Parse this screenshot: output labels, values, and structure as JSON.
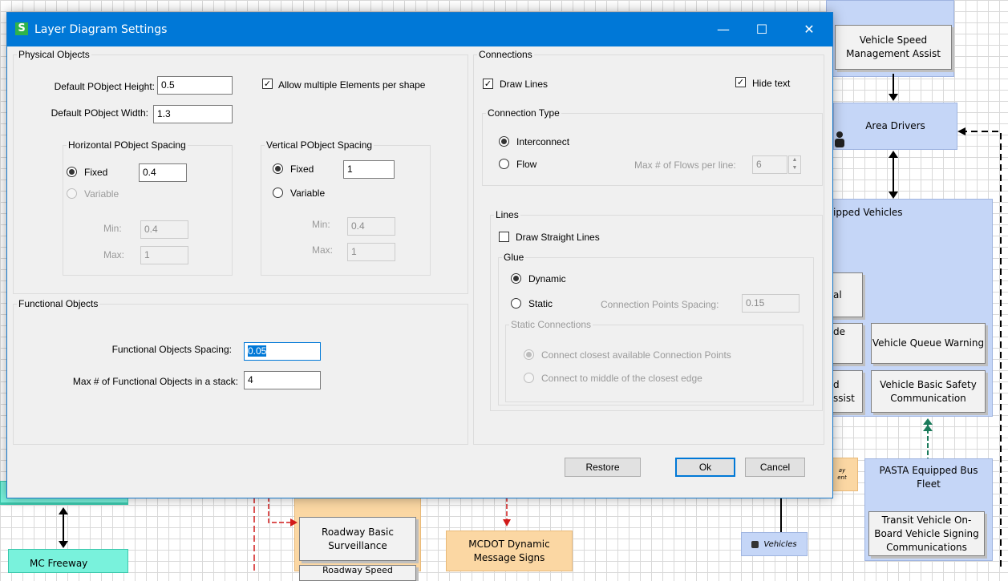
{
  "window": {
    "title": "Layer Diagram Settings",
    "logo_letter": "S",
    "minimize_glyph": "—",
    "maximize_glyph": "☐",
    "close_glyph": "✕"
  },
  "physical": {
    "legend": "Physical Objects",
    "height_label": "Default PObject Height:",
    "height_value": "0.5",
    "width_label": "Default PObject Width:",
    "width_value": "1.3",
    "allow_multiple_label": "Allow multiple Elements per shape",
    "allow_multiple_checked": true,
    "horizontal": {
      "legend": "Horizontal PObject Spacing",
      "fixed_label": "Fixed",
      "fixed_value": "0.4",
      "variable_label": "Variable",
      "min_label": "Min:",
      "min_value": "0.4",
      "max_label": "Max:",
      "max_value": "1"
    },
    "vertical": {
      "legend": "Vertical PObject Spacing",
      "fixed_label": "Fixed",
      "fixed_value": "1",
      "variable_label": "Variable",
      "min_label": "Min:",
      "min_value": "0.4",
      "max_label": "Max:",
      "max_value": "1"
    }
  },
  "functional": {
    "legend": "Functional Objects",
    "spacing_label": "Functional Objects Spacing:",
    "spacing_value": "0.05",
    "max_stack_label": "Max # of Functional Objects in a stack:",
    "max_stack_value": "4"
  },
  "connections": {
    "legend": "Connections",
    "draw_lines_label": "Draw Lines",
    "hide_text_label": "Hide text",
    "type": {
      "legend": "Connection Type",
      "interconnect_label": "Interconnect",
      "flow_label": "Flow",
      "max_flows_label": "Max # of Flows per line:",
      "max_flows_value": "6",
      "selected": "Interconnect"
    },
    "lines": {
      "legend": "Lines",
      "straight_label": "Draw Straight Lines",
      "glue": {
        "legend": "Glue",
        "dynamic_label": "Dynamic",
        "static_label": "Static",
        "spacing_label": "Connection Points Spacing:",
        "spacing_value": "0.15",
        "selected": "Dynamic"
      },
      "static_connections": {
        "legend": "Static Connections",
        "closest_label": "Connect closest available Connection Points",
        "middle_label": "Connect to middle of the closest edge"
      }
    }
  },
  "buttons": {
    "restore": "Restore",
    "ok": "Ok",
    "cancel": "Cancel"
  },
  "diagram": {
    "nodes": {
      "speed_mgmt": "Vehicle Speed Management Assist",
      "area_drivers": "Area Drivers",
      "equipped_vehicles": "ipped Vehicles",
      "frag_al": "al",
      "frag_de": "de",
      "frag_d": "d",
      "frag_ssist": "ssist",
      "queue_warning": "Vehicle Queue Warning",
      "basic_safety": "Vehicle Basic Safety Communication",
      "frag_orange": "ay\nent",
      "pasta_bus": "PASTA Equipped Bus Fleet",
      "transit_signing": "Transit Vehicle On-Board Vehicle Signing Communications",
      "roadway_surveillance": "Roadway Basic Surveillance",
      "roadway_speed": "Roadway Speed",
      "mcdot_signs": "MCDOT Dynamic Message Signs",
      "vehicles": "Vehicles",
      "mc_freeway": "MC Freeway"
    },
    "colors": {
      "gray_node": "#f2f2f2",
      "blue_node": "#c5d6f7",
      "orange_node": "#fbd7a3",
      "teal_node": "#79f2dc",
      "flow_red": "#d11a1a",
      "flow_green": "#1a7a5a"
    }
  }
}
